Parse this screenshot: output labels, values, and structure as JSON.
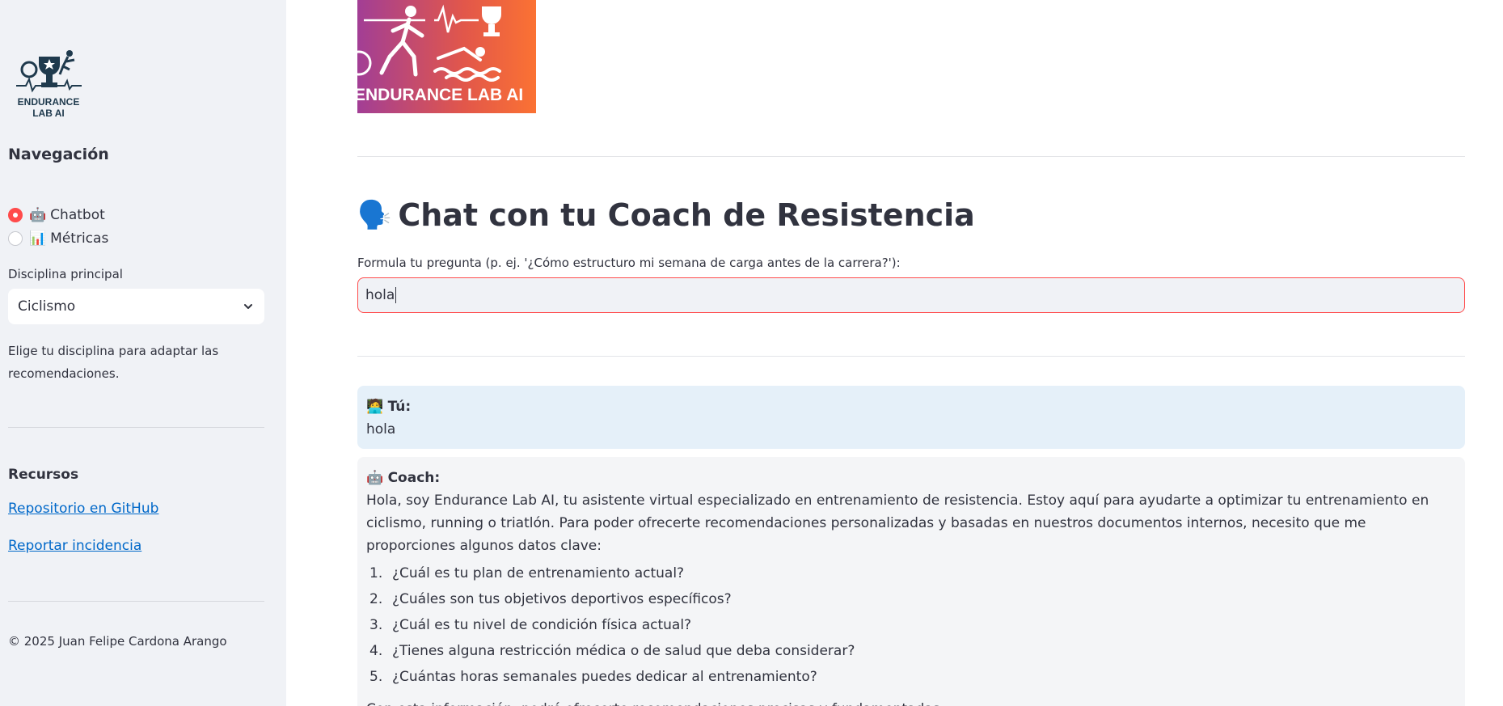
{
  "sidebar": {
    "logo_text": "ENDURANCE LAB AI",
    "nav_title": "Navegación",
    "radio_options": [
      {
        "emoji": "🤖",
        "label": "Chatbot",
        "selected": true
      },
      {
        "emoji": "📊",
        "label": "Métricas",
        "selected": false
      }
    ],
    "discipline_label": "Disciplina principal",
    "discipline_value": "Ciclismo",
    "discipline_help": "Elige tu disciplina para adaptar las recomendaciones.",
    "resources_title": "Recursos",
    "links": [
      "Repositorio en GitHub",
      "Reportar incidencia"
    ],
    "footer": "© 2025 Juan Felipe Cardona Arango"
  },
  "banner": {
    "text": "ENDURANCE LAB AI",
    "icons": [
      "bike-icon",
      "runner-icon",
      "heartbeat-icon",
      "trophy-icon",
      "swimmer-icon"
    ]
  },
  "main": {
    "title_emoji": "🗣️",
    "title": "Chat con tu Coach de Resistencia",
    "input_label": "Formula tu pregunta (p. ej. '¿Cómo estructuro mi semana de carga antes de la carrera?'):",
    "input_value": "hola"
  },
  "chat": {
    "user": {
      "emoji": "🧑‍💻",
      "name": "Tú:",
      "text": "hola"
    },
    "coach": {
      "emoji": "🤖",
      "name": "Coach:",
      "intro": "Hola, soy Endurance Lab AI, tu asistente virtual especializado en entrenamiento de resistencia. Estoy aquí para ayudarte a optimizar tu entrenamiento en ciclismo, running o triatlón. Para poder ofrecerte recomendaciones personalizadas y basadas en nuestros documentos internos, necesito que me proporciones algunos datos clave:",
      "questions": [
        "¿Cuál es tu plan de entrenamiento actual?",
        "¿Cuáles son tus objetivos deportivos específicos?",
        "¿Cuál es tu nivel de condición física actual?",
        "¿Tienes alguna restricción médica o de salud que deba considerar?",
        "¿Cuántas horas semanales puedes dedicar al entrenamiento?"
      ],
      "closing": "Con esta información, podré ofrecerte recomendaciones precisas y fundamentadas."
    }
  },
  "colors": {
    "accent": "#ff4b4b",
    "link": "#0068c9",
    "sidebar_bg": "#f0f2f6",
    "user_bubble": "#e5f0f9",
    "coach_bubble": "#f4f5f7"
  }
}
